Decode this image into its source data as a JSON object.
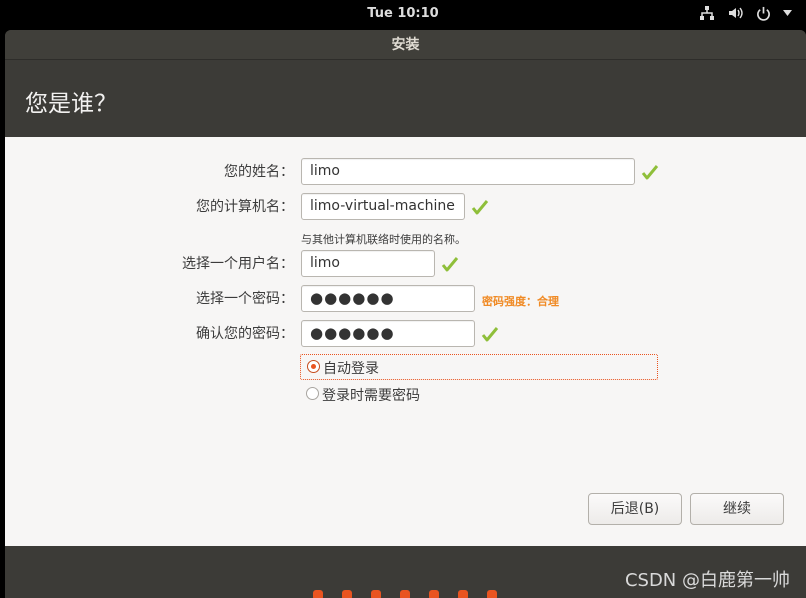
{
  "topbar": {
    "clock": "Tue 10:10"
  },
  "window": {
    "title": "安装",
    "heading": "您是谁？"
  },
  "form": {
    "name_label": "您的姓名：",
    "name_value": "limo",
    "computer_label": "您的计算机名：",
    "computer_value": "limo-virtual-machine",
    "computer_hint": "与其他计算机联络时使用的名称。",
    "username_label": "选择一个用户名：",
    "username_value": "limo",
    "password_label": "选择一个密码：",
    "password_value": "●●●●●●",
    "password_strength": "密码强度：合理",
    "confirm_label": "确认您的密码：",
    "confirm_value": "●●●●●●",
    "login_auto": "自动登录",
    "login_password": "登录时需要密码"
  },
  "buttons": {
    "back": "后退(B)",
    "continue": "继续"
  },
  "watermark": "CSDN @白鹿第一帅",
  "colors": {
    "accent": "#e95420",
    "check": "#8fbf3a",
    "strength": "#f08a24"
  }
}
